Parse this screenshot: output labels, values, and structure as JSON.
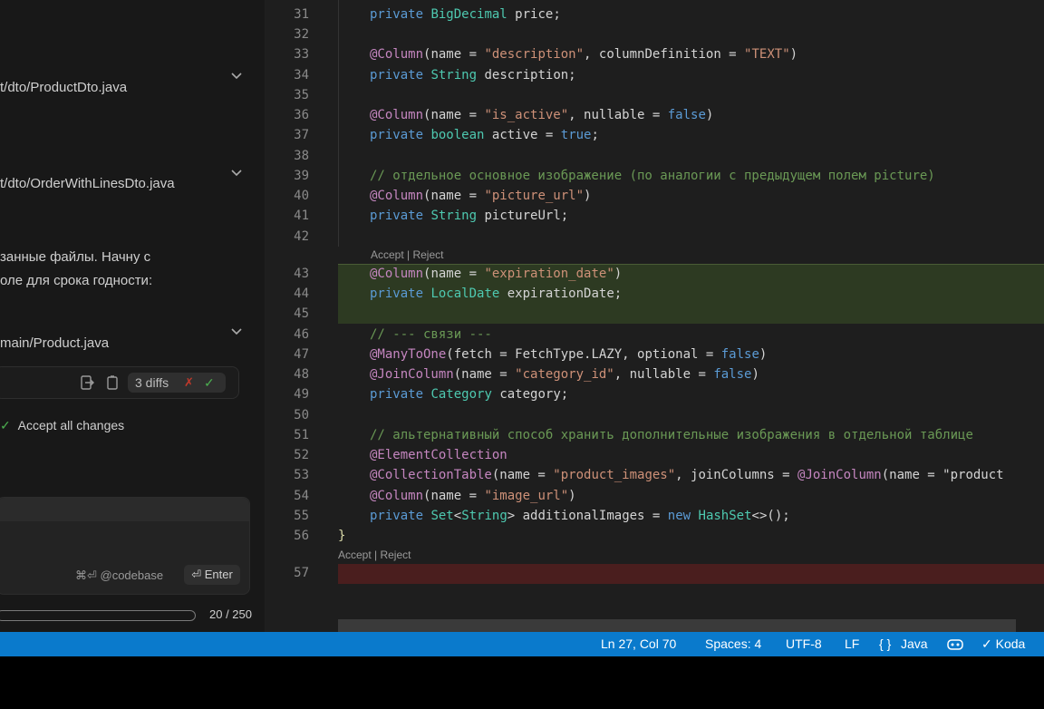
{
  "chat": {
    "files": [
      {
        "path": "t/dto/ProductDto.java"
      },
      {
        "path": "t/dto/OrderWithLinesDto.java"
      },
      {
        "path": "main/Product.java"
      }
    ],
    "message_lines": [
      "занные файлы. Начну с",
      "оле для срока годности:"
    ],
    "diff_count": "3 diffs",
    "accept_all": "Accept all changes",
    "input": {
      "codebase_hint": "⌘⏎ @codebase",
      "enter_label": "⏎ Enter"
    },
    "usage": {
      "count": "20 / 250",
      "fraction": 0.08
    }
  },
  "editor": {
    "lines": [
      {
        "num": "31",
        "code": "private BigDecimal price;"
      },
      {
        "num": "32",
        "code": ""
      },
      {
        "num": "33",
        "code": "@Column(name = \"description\", columnDefinition = \"TEXT\")"
      },
      {
        "num": "34",
        "code": "private String description;"
      },
      {
        "num": "35",
        "code": ""
      },
      {
        "num": "36",
        "code": "@Column(name = \"is_active\", nullable = false)"
      },
      {
        "num": "37",
        "code": "private boolean active = true;"
      },
      {
        "num": "38",
        "code": ""
      },
      {
        "num": "39",
        "code": "// отдельное основное изображение (по аналогии с предыдущем полем picture)"
      },
      {
        "num": "40",
        "code": "@Column(name = \"picture_url\")"
      },
      {
        "num": "41",
        "code": "private String pictureUrl;"
      },
      {
        "num": "42",
        "code": ""
      },
      {
        "num": "43",
        "code": "@Column(name = \"expiration_date\")"
      },
      {
        "num": "44",
        "code": "private LocalDate expirationDate;"
      },
      {
        "num": "45",
        "code": ""
      },
      {
        "num": "46",
        "code": "// --- связи ---"
      },
      {
        "num": "47",
        "code": "@ManyToOne(fetch = FetchType.LAZY, optional = false)"
      },
      {
        "num": "48",
        "code": "@JoinColumn(name = \"category_id\", nullable = false)"
      },
      {
        "num": "49",
        "code": "private Category category;"
      },
      {
        "num": "50",
        "code": ""
      },
      {
        "num": "51",
        "code": "// альтернативный способ хранить дополнительные изображения в отдельной таблице"
      },
      {
        "num": "52",
        "code": "@ElementCollection"
      },
      {
        "num": "53",
        "code": "@CollectionTable(name = \"product_images\", joinColumns = @JoinColumn(name = \"product"
      },
      {
        "num": "54",
        "code": "@Column(name = \"image_url\")"
      },
      {
        "num": "55",
        "code": "private Set<String> additionalImages = new HashSet<>();"
      },
      {
        "num": "56",
        "code": "}"
      },
      {
        "num": "57",
        "code": ""
      }
    ],
    "lens_1": "Accept | Reject",
    "lens_2": "Accept | Reject"
  },
  "status": {
    "position": "Ln 27, Col 70",
    "spaces": "Spaces: 4",
    "encoding": "UTF-8",
    "eol": "LF",
    "language": "Java",
    "extension": "Koda"
  },
  "colors": {
    "status_bar": "#0a7acc",
    "added_bg": "#2d3a22",
    "removed_bg": "#4a1e1e"
  }
}
